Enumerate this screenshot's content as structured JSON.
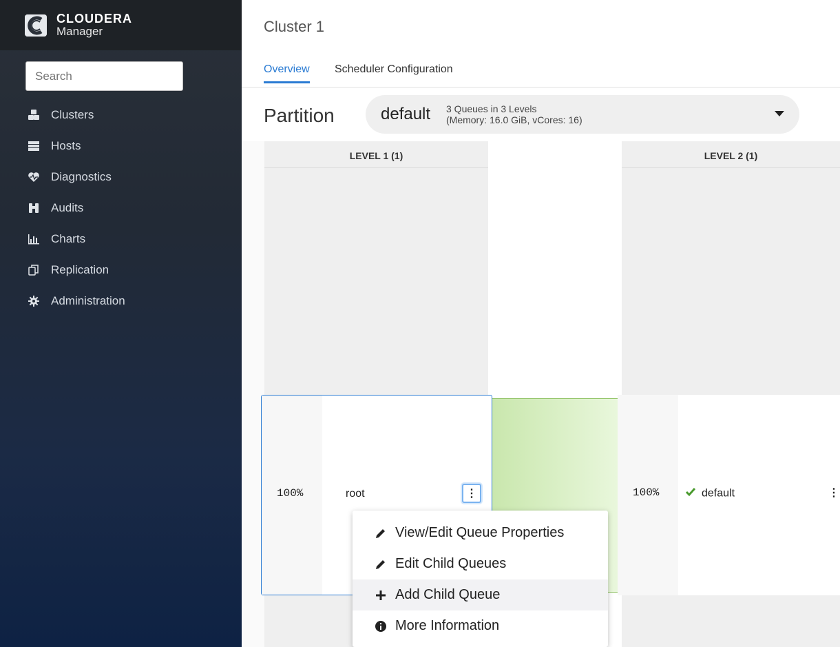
{
  "brand": {
    "name": "CLOUDERA",
    "product": "Manager"
  },
  "sidebar": {
    "search_placeholder": "Search",
    "items": [
      {
        "label": "Clusters",
        "icon": "cubes-icon"
      },
      {
        "label": "Hosts",
        "icon": "server-icon"
      },
      {
        "label": "Diagnostics",
        "icon": "heartbeat-icon"
      },
      {
        "label": "Audits",
        "icon": "binoculars-icon"
      },
      {
        "label": "Charts",
        "icon": "bar-chart-icon"
      },
      {
        "label": "Replication",
        "icon": "copy-icon"
      },
      {
        "label": "Administration",
        "icon": "gear-icon"
      }
    ]
  },
  "header": {
    "title": "Cluster 1"
  },
  "tabs": [
    {
      "label": "Overview",
      "active": true
    },
    {
      "label": "Scheduler Configuration",
      "active": false
    }
  ],
  "partition": {
    "label": "Partition",
    "value": "default",
    "summary_line1": "3 Queues in 3 Levels",
    "summary_line2": "(Memory: 16.0 GiB, vCores: 16)"
  },
  "levels": [
    {
      "header": "LEVEL 1 (1)"
    },
    {
      "header": "LEVEL 2 (1)"
    }
  ],
  "queues": {
    "root": {
      "percent": "100%",
      "name": "root"
    },
    "default": {
      "percent": "100%",
      "name": "default",
      "status": "check-icon"
    }
  },
  "menu": {
    "items": [
      {
        "label": "View/Edit Queue Properties",
        "icon": "pencil-icon"
      },
      {
        "label": "Edit Child Queues",
        "icon": "pencil-icon"
      },
      {
        "label": "Add Child Queue",
        "icon": "plus-icon",
        "hovered": true
      },
      {
        "label": "More Information",
        "icon": "info-icon"
      }
    ]
  },
  "colors": {
    "accent": "#2a7bd3",
    "flow_green": "#c9e7ad",
    "check_green": "#4a9a2e"
  }
}
